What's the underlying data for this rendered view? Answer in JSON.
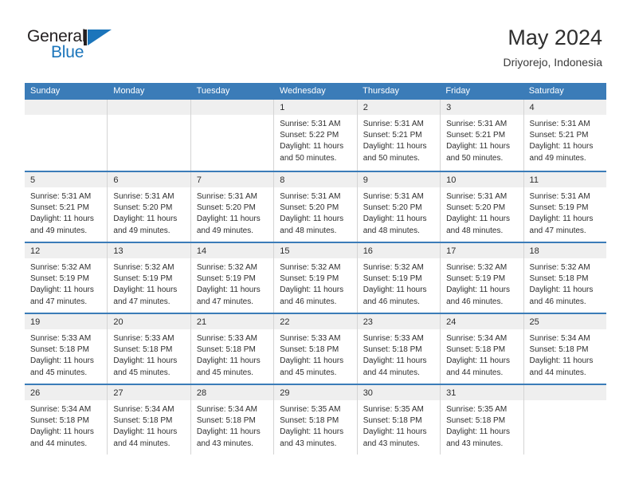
{
  "brand": {
    "name_top": "General",
    "name_bottom": "Blue",
    "accent_color": "#1b75bb",
    "dark_color": "#231f20"
  },
  "header": {
    "title": "May 2024",
    "subtitle": "Driyorejo, Indonesia"
  },
  "theme": {
    "header_band": "#3b7cb8",
    "day_band": "#efefef",
    "cell_divider": "#d4d4d4",
    "text": "#2e2e2e"
  },
  "weekdays": [
    "Sunday",
    "Monday",
    "Tuesday",
    "Wednesday",
    "Thursday",
    "Friday",
    "Saturday"
  ],
  "weeks": [
    [
      {
        "day": "",
        "sunrise": "",
        "sunset": "",
        "daylight_1": "",
        "daylight_2": ""
      },
      {
        "day": "",
        "sunrise": "",
        "sunset": "",
        "daylight_1": "",
        "daylight_2": ""
      },
      {
        "day": "",
        "sunrise": "",
        "sunset": "",
        "daylight_1": "",
        "daylight_2": ""
      },
      {
        "day": "1",
        "sunrise": "Sunrise: 5:31 AM",
        "sunset": "Sunset: 5:22 PM",
        "daylight_1": "Daylight: 11 hours",
        "daylight_2": "and 50 minutes."
      },
      {
        "day": "2",
        "sunrise": "Sunrise: 5:31 AM",
        "sunset": "Sunset: 5:21 PM",
        "daylight_1": "Daylight: 11 hours",
        "daylight_2": "and 50 minutes."
      },
      {
        "day": "3",
        "sunrise": "Sunrise: 5:31 AM",
        "sunset": "Sunset: 5:21 PM",
        "daylight_1": "Daylight: 11 hours",
        "daylight_2": "and 50 minutes."
      },
      {
        "day": "4",
        "sunrise": "Sunrise: 5:31 AM",
        "sunset": "Sunset: 5:21 PM",
        "daylight_1": "Daylight: 11 hours",
        "daylight_2": "and 49 minutes."
      }
    ],
    [
      {
        "day": "5",
        "sunrise": "Sunrise: 5:31 AM",
        "sunset": "Sunset: 5:21 PM",
        "daylight_1": "Daylight: 11 hours",
        "daylight_2": "and 49 minutes."
      },
      {
        "day": "6",
        "sunrise": "Sunrise: 5:31 AM",
        "sunset": "Sunset: 5:20 PM",
        "daylight_1": "Daylight: 11 hours",
        "daylight_2": "and 49 minutes."
      },
      {
        "day": "7",
        "sunrise": "Sunrise: 5:31 AM",
        "sunset": "Sunset: 5:20 PM",
        "daylight_1": "Daylight: 11 hours",
        "daylight_2": "and 49 minutes."
      },
      {
        "day": "8",
        "sunrise": "Sunrise: 5:31 AM",
        "sunset": "Sunset: 5:20 PM",
        "daylight_1": "Daylight: 11 hours",
        "daylight_2": "and 48 minutes."
      },
      {
        "day": "9",
        "sunrise": "Sunrise: 5:31 AM",
        "sunset": "Sunset: 5:20 PM",
        "daylight_1": "Daylight: 11 hours",
        "daylight_2": "and 48 minutes."
      },
      {
        "day": "10",
        "sunrise": "Sunrise: 5:31 AM",
        "sunset": "Sunset: 5:20 PM",
        "daylight_1": "Daylight: 11 hours",
        "daylight_2": "and 48 minutes."
      },
      {
        "day": "11",
        "sunrise": "Sunrise: 5:31 AM",
        "sunset": "Sunset: 5:19 PM",
        "daylight_1": "Daylight: 11 hours",
        "daylight_2": "and 47 minutes."
      }
    ],
    [
      {
        "day": "12",
        "sunrise": "Sunrise: 5:32 AM",
        "sunset": "Sunset: 5:19 PM",
        "daylight_1": "Daylight: 11 hours",
        "daylight_2": "and 47 minutes."
      },
      {
        "day": "13",
        "sunrise": "Sunrise: 5:32 AM",
        "sunset": "Sunset: 5:19 PM",
        "daylight_1": "Daylight: 11 hours",
        "daylight_2": "and 47 minutes."
      },
      {
        "day": "14",
        "sunrise": "Sunrise: 5:32 AM",
        "sunset": "Sunset: 5:19 PM",
        "daylight_1": "Daylight: 11 hours",
        "daylight_2": "and 47 minutes."
      },
      {
        "day": "15",
        "sunrise": "Sunrise: 5:32 AM",
        "sunset": "Sunset: 5:19 PM",
        "daylight_1": "Daylight: 11 hours",
        "daylight_2": "and 46 minutes."
      },
      {
        "day": "16",
        "sunrise": "Sunrise: 5:32 AM",
        "sunset": "Sunset: 5:19 PM",
        "daylight_1": "Daylight: 11 hours",
        "daylight_2": "and 46 minutes."
      },
      {
        "day": "17",
        "sunrise": "Sunrise: 5:32 AM",
        "sunset": "Sunset: 5:19 PM",
        "daylight_1": "Daylight: 11 hours",
        "daylight_2": "and 46 minutes."
      },
      {
        "day": "18",
        "sunrise": "Sunrise: 5:32 AM",
        "sunset": "Sunset: 5:18 PM",
        "daylight_1": "Daylight: 11 hours",
        "daylight_2": "and 46 minutes."
      }
    ],
    [
      {
        "day": "19",
        "sunrise": "Sunrise: 5:33 AM",
        "sunset": "Sunset: 5:18 PM",
        "daylight_1": "Daylight: 11 hours",
        "daylight_2": "and 45 minutes."
      },
      {
        "day": "20",
        "sunrise": "Sunrise: 5:33 AM",
        "sunset": "Sunset: 5:18 PM",
        "daylight_1": "Daylight: 11 hours",
        "daylight_2": "and 45 minutes."
      },
      {
        "day": "21",
        "sunrise": "Sunrise: 5:33 AM",
        "sunset": "Sunset: 5:18 PM",
        "daylight_1": "Daylight: 11 hours",
        "daylight_2": "and 45 minutes."
      },
      {
        "day": "22",
        "sunrise": "Sunrise: 5:33 AM",
        "sunset": "Sunset: 5:18 PM",
        "daylight_1": "Daylight: 11 hours",
        "daylight_2": "and 45 minutes."
      },
      {
        "day": "23",
        "sunrise": "Sunrise: 5:33 AM",
        "sunset": "Sunset: 5:18 PM",
        "daylight_1": "Daylight: 11 hours",
        "daylight_2": "and 44 minutes."
      },
      {
        "day": "24",
        "sunrise": "Sunrise: 5:34 AM",
        "sunset": "Sunset: 5:18 PM",
        "daylight_1": "Daylight: 11 hours",
        "daylight_2": "and 44 minutes."
      },
      {
        "day": "25",
        "sunrise": "Sunrise: 5:34 AM",
        "sunset": "Sunset: 5:18 PM",
        "daylight_1": "Daylight: 11 hours",
        "daylight_2": "and 44 minutes."
      }
    ],
    [
      {
        "day": "26",
        "sunrise": "Sunrise: 5:34 AM",
        "sunset": "Sunset: 5:18 PM",
        "daylight_1": "Daylight: 11 hours",
        "daylight_2": "and 44 minutes."
      },
      {
        "day": "27",
        "sunrise": "Sunrise: 5:34 AM",
        "sunset": "Sunset: 5:18 PM",
        "daylight_1": "Daylight: 11 hours",
        "daylight_2": "and 44 minutes."
      },
      {
        "day": "28",
        "sunrise": "Sunrise: 5:34 AM",
        "sunset": "Sunset: 5:18 PM",
        "daylight_1": "Daylight: 11 hours",
        "daylight_2": "and 43 minutes."
      },
      {
        "day": "29",
        "sunrise": "Sunrise: 5:35 AM",
        "sunset": "Sunset: 5:18 PM",
        "daylight_1": "Daylight: 11 hours",
        "daylight_2": "and 43 minutes."
      },
      {
        "day": "30",
        "sunrise": "Sunrise: 5:35 AM",
        "sunset": "Sunset: 5:18 PM",
        "daylight_1": "Daylight: 11 hours",
        "daylight_2": "and 43 minutes."
      },
      {
        "day": "31",
        "sunrise": "Sunrise: 5:35 AM",
        "sunset": "Sunset: 5:18 PM",
        "daylight_1": "Daylight: 11 hours",
        "daylight_2": "and 43 minutes."
      },
      {
        "day": "",
        "sunrise": "",
        "sunset": "",
        "daylight_1": "",
        "daylight_2": ""
      }
    ]
  ]
}
